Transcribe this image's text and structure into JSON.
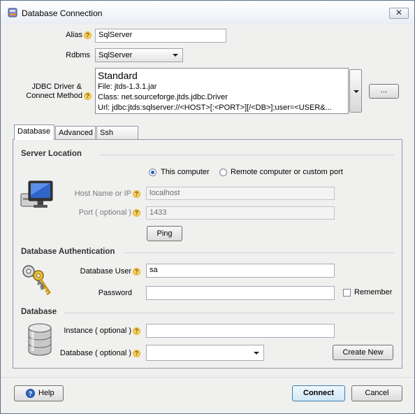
{
  "window": {
    "title": "Database Connection",
    "close_glyph": "✕"
  },
  "form": {
    "alias_label": "Alias",
    "alias_value": "SqlServer",
    "rdbms_label": "Rdbms",
    "rdbms_value": "SqlServer",
    "driver_label_line1": "JDBC Driver &",
    "driver_label_line2": "Connect Method",
    "driver": {
      "name": "Standard",
      "file": "File: jtds-1.3.1.jar",
      "class": "Class: net.sourceforge.jtds.jdbc.Driver",
      "url": "Url: jdbc:jtds:sqlserver://<HOST>[:<PORT>][/<DB>];user=<USER&..."
    },
    "browse_label": "..."
  },
  "tabs": [
    {
      "label": "Database",
      "active": true
    },
    {
      "label": "Advanced",
      "active": false
    },
    {
      "label": "Ssh Tunnel",
      "active": false
    }
  ],
  "server_location": {
    "heading": "Server Location",
    "this_computer": "This computer",
    "remote": "Remote computer or custom port",
    "selected": "this_computer",
    "host_label": "Host Name or IP",
    "host_value": "localhost",
    "port_label": "Port ( optional )",
    "port_value": "1433",
    "ping_label": "Ping"
  },
  "auth": {
    "heading": "Database Authentication",
    "user_label": "Database User",
    "user_value": "sa",
    "password_label": "Password",
    "password_value": "",
    "remember_label": "Remember",
    "remember_checked": false
  },
  "database": {
    "heading": "Database",
    "instance_label": "Instance ( optional )",
    "instance_value": "",
    "db_label": "Database ( optional )",
    "db_value": "",
    "create_new_label": "Create New"
  },
  "footer": {
    "help_label": "Help",
    "connect_label": "Connect",
    "cancel_label": "Cancel"
  },
  "colors": {
    "accent": "#1b62b8",
    "help_icon": "#e2a010",
    "window_bg": "#f0f0ef"
  },
  "help_glyph": "?"
}
